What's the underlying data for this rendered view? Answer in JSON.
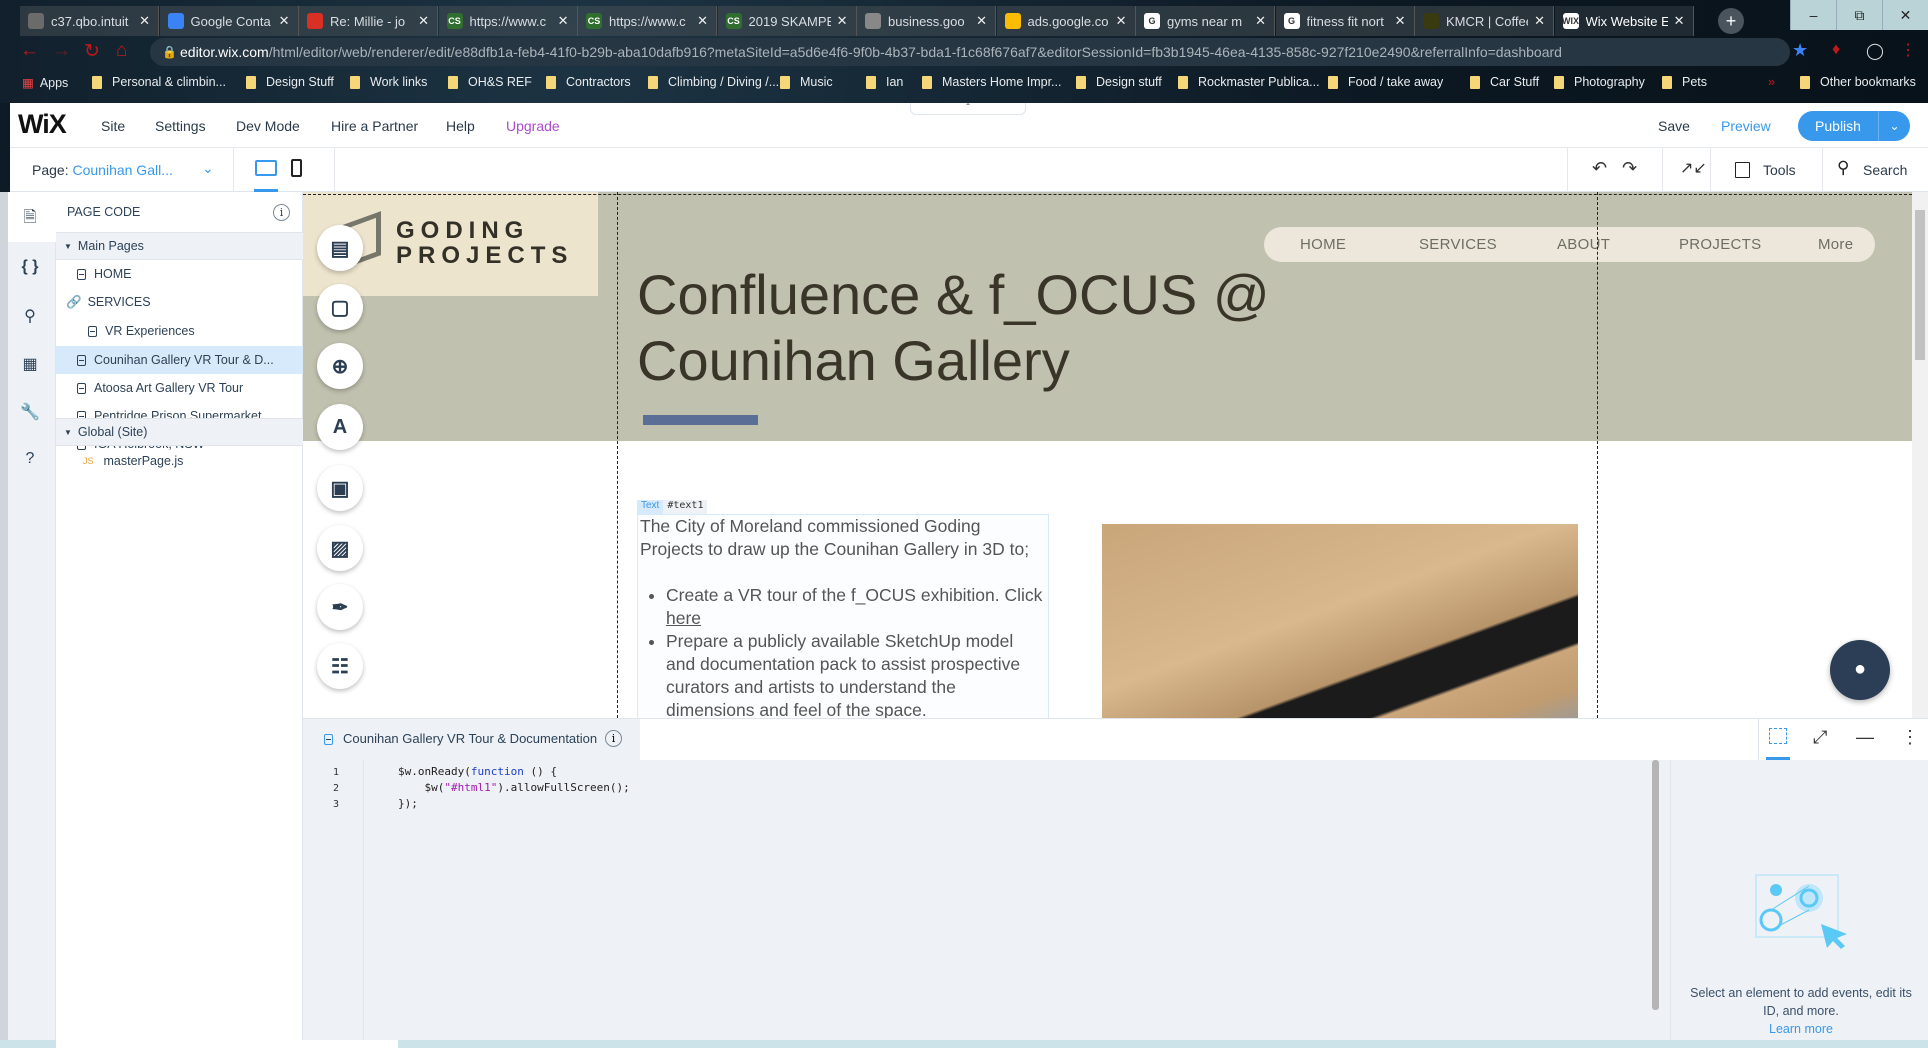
{
  "browser": {
    "tabs": [
      {
        "label": "c37.qbo.intuit",
        "icon": "qb-icon",
        "color": "#6b6b6b"
      },
      {
        "label": "Google Conta",
        "icon": "contacts-icon",
        "color": "#3b82f6"
      },
      {
        "label": "Re: Millie - jo",
        "icon": "gmail-icon",
        "color": "#d93025"
      },
      {
        "label": "https://www.c",
        "icon": "cs-icon",
        "color": "#2f6e2f",
        "fav": "CS"
      },
      {
        "label": "https://www.c",
        "icon": "cs-icon",
        "color": "#2f6e2f",
        "fav": "CS"
      },
      {
        "label": "2019 SKAMPE",
        "icon": "cs-icon",
        "color": "#2f6e2f",
        "fav": "CS"
      },
      {
        "label": "business.goo",
        "icon": "page-icon",
        "color": "#888888"
      },
      {
        "label": "ads.google.co",
        "icon": "google-ads-icon",
        "color": "#fbbc04"
      },
      {
        "label": "gyms near m",
        "icon": "google-icon",
        "color": "#ffffff",
        "fav": "G"
      },
      {
        "label": "fitness fit nort",
        "icon": "google-icon",
        "color": "#ffffff",
        "fav": "G"
      },
      {
        "label": "KMCR | Coffee",
        "icon": "kmcr-icon",
        "color": "#3a3a10"
      },
      {
        "label": "Wix Website E",
        "icon": "wix-icon",
        "color": "#ffffff",
        "fav": "WIX"
      }
    ],
    "new_tab": "+",
    "url_host": "editor.wix.com",
    "url_path": "/html/editor/web/renderer/edit/e88dfb1a-feb4-41f0-b29b-aba10dafb916?metaSiteId=a5d6e4f6-9f0b-4b37-bda1-f1c68f676af7&editorSessionId=fb3b1945-46ea-4135-858c-927f210e2490&referralInfo=dashboard",
    "bookmarks": [
      "Apps",
      "Personal & climbin...",
      "Design Stuff",
      "Work links",
      "OH&S REF",
      "Contractors",
      "Climbing / Diving /...",
      "Music",
      "Ian",
      "Masters Home Impr...",
      "Design stuff",
      "Rockmaster Publica...",
      "Food / take away",
      "Car Stuff",
      "Photography",
      "Pets"
    ],
    "more_bookmarks": "»",
    "other_bookmarks": "Other bookmarks"
  },
  "editor": {
    "logo": "WiX",
    "menu": [
      "Site",
      "Settings",
      "Dev Mode",
      "Hire a Partner",
      "Help",
      "Upgrade"
    ],
    "save": "Save",
    "preview": "Preview",
    "publish": "Publish",
    "page_label": "Page:",
    "page_value": "Counihan Gall...",
    "tools": "Tools",
    "search": "Search",
    "accent": "#3899ec",
    "upgrade_color": "#aa4dc8"
  },
  "page_code": {
    "title": "PAGE CODE",
    "main_pages": "Main Pages",
    "pages": [
      {
        "label": "HOME",
        "type": "page"
      },
      {
        "label": "SERVICES",
        "type": "link"
      },
      {
        "label": "VR Experiences",
        "type": "subpage"
      },
      {
        "label": "Counihan Gallery VR Tour & D...",
        "type": "page",
        "selected": true
      },
      {
        "label": "Atoosa Art Gallery VR Tour",
        "type": "page"
      },
      {
        "label": "Pentridge Prison Supermarket...",
        "type": "page"
      },
      {
        "label": "IGA Holbrook, NSW",
        "type": "page"
      }
    ],
    "global": "Global (Site)",
    "global_files": [
      {
        "label": "masterPage.js",
        "badge": "JS"
      }
    ]
  },
  "site": {
    "logo_line1": "GODING",
    "logo_line2": "PROJECTS",
    "nav": [
      "HOME",
      "SERVICES",
      "ABOUT",
      "PROJECTS",
      "More"
    ],
    "title": "Confluence & f_OCUS @ Counihan Gallery",
    "text_tag_type": "Text",
    "text_tag_id": "#text1",
    "intro": "The City of Moreland commissioned Goding Projects to draw up the Counihan Gallery in 3D to;",
    "bullet1_text": "Create a VR tour of the f_OCUS exhibition. Click ",
    "bullet1_link": "here",
    "bullet2": "Prepare a publicly available SketchUp model and documentation pack to assist prospective curators and artists to understand the dimensions and feel of the space.",
    "header_color": "#c0c1ae",
    "logo_bg": "#ece4cc",
    "accent_bar": "#5b6f96"
  },
  "code_panel": {
    "file_title": "Counihan Gallery VR Tour & Documentation",
    "line_numbers": [
      "1",
      "2",
      "3"
    ],
    "properties_text": "Select an element to add events, edit its ID, and more.",
    "learn_more": "Learn more"
  }
}
